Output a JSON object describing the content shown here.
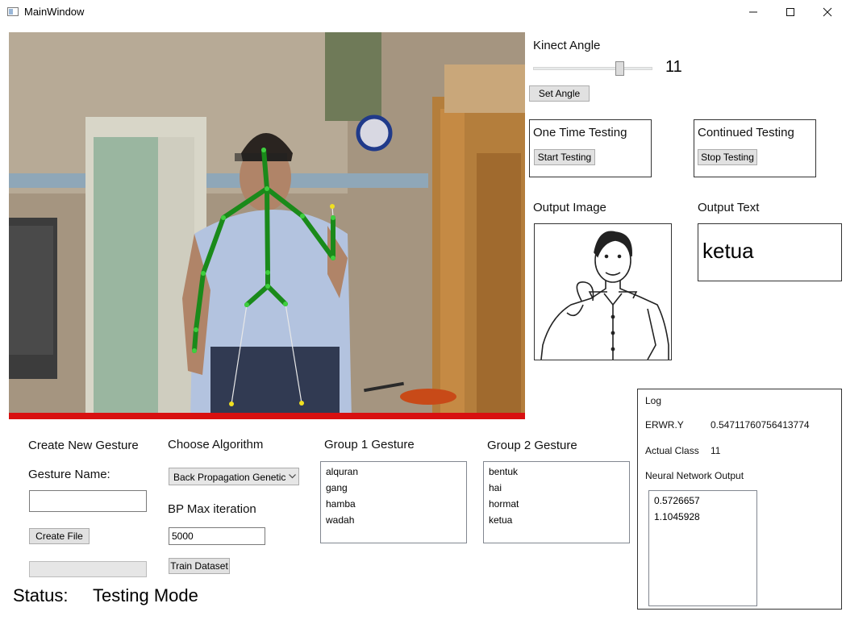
{
  "window": {
    "title": "MainWindow"
  },
  "kinect": {
    "label": "Kinect Angle",
    "angle_value": "11",
    "slider_fraction": 0.72,
    "set_angle_label": "Set Angle"
  },
  "one_time": {
    "title": "One Time Testing",
    "button": "Start Testing"
  },
  "continued": {
    "title": "Continued Testing",
    "button": "Stop Testing"
  },
  "output_image": {
    "label": "Output Image"
  },
  "output_text": {
    "label": "Output Text",
    "value": "ketua"
  },
  "log": {
    "title": "Log",
    "rows": [
      {
        "key": "ERWR.Y",
        "value": "0.54711760756413774"
      },
      {
        "key": "Actual Class",
        "value": "11"
      }
    ],
    "nn_label": "Neural Network Output",
    "nn_values": [
      "0.5726657",
      "1.1045928"
    ]
  },
  "create_gesture": {
    "title": "Create New Gesture",
    "name_label": "Gesture Name:",
    "name_value": "",
    "create_button": "Create File"
  },
  "algorithm": {
    "title": "Choose Algorithm",
    "selected": "Back Propagation Genetic",
    "bp_label": "BP Max iteration",
    "bp_value": "5000",
    "train_button": "Train Dataset"
  },
  "group1": {
    "title": "Group 1 Gesture",
    "items": [
      "alquran",
      "gang",
      "hamba",
      "wadah"
    ]
  },
  "group2": {
    "title": "Group 2 Gesture",
    "items": [
      "bentuk",
      "hai",
      "hormat",
      "ketua"
    ]
  },
  "status": {
    "label": "Status:",
    "value": "Testing Mode"
  },
  "colors": {
    "skeleton": "#1a8a1a",
    "joint": "#3fcf3f",
    "leaf_joint": "#f0e020",
    "floor_bar": "#d81010"
  }
}
